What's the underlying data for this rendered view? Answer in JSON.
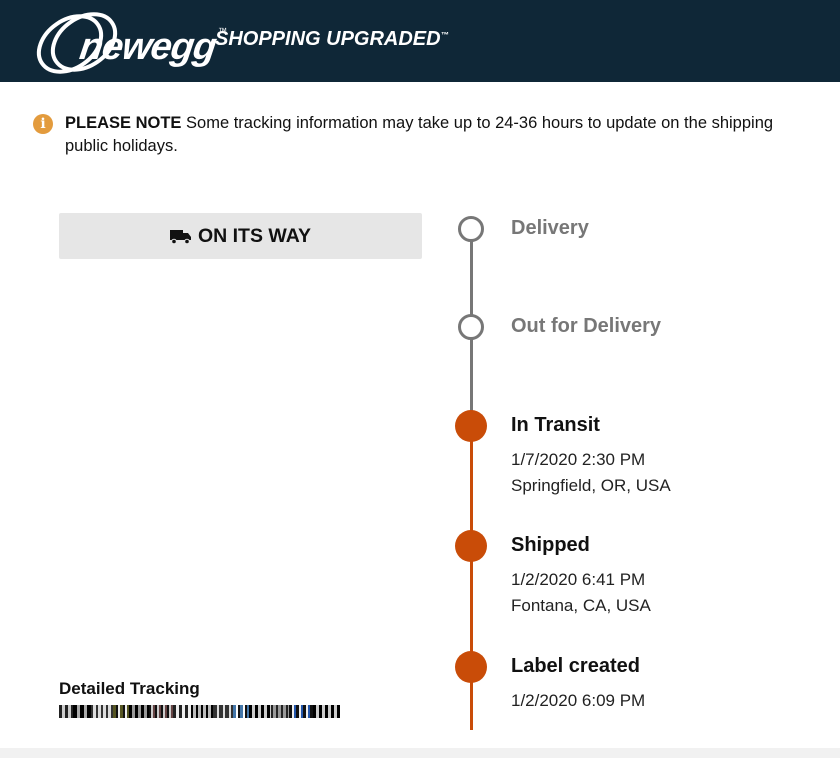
{
  "header": {
    "logo_text": "newegg",
    "logo_tm": "™",
    "tagline": "SHOPPING UPGRADED",
    "tagline_tm": "™"
  },
  "notice": {
    "icon": "info-icon",
    "bold": "PLEASE NOTE",
    "line1": " Some tracking information may take up to 24-36 hours to update on the shipping",
    "line2": "public holidays."
  },
  "status": {
    "icon": "truck-icon",
    "label": "ON ITS WAY"
  },
  "timeline": [
    {
      "title": "Delivery",
      "state": "pending",
      "lines": []
    },
    {
      "title": "Out for Delivery",
      "state": "pending",
      "lines": []
    },
    {
      "title": "In Transit",
      "state": "done",
      "lines": [
        "1/7/2020 2:30 PM",
        "Springfield, OR, USA"
      ]
    },
    {
      "title": "Shipped",
      "state": "done",
      "lines": [
        "1/2/2020 6:41 PM",
        "Fontana, CA, USA"
      ]
    },
    {
      "title": "Label created",
      "state": "done",
      "lines": [
        "1/2/2020 6:09 PM"
      ]
    }
  ],
  "detailed_tracking": {
    "title": "Detailed Tracking"
  },
  "colors": {
    "header_bg": "#0f2737",
    "accent": "#c94c08",
    "pending": "#777777",
    "info": "#e39b3d"
  }
}
